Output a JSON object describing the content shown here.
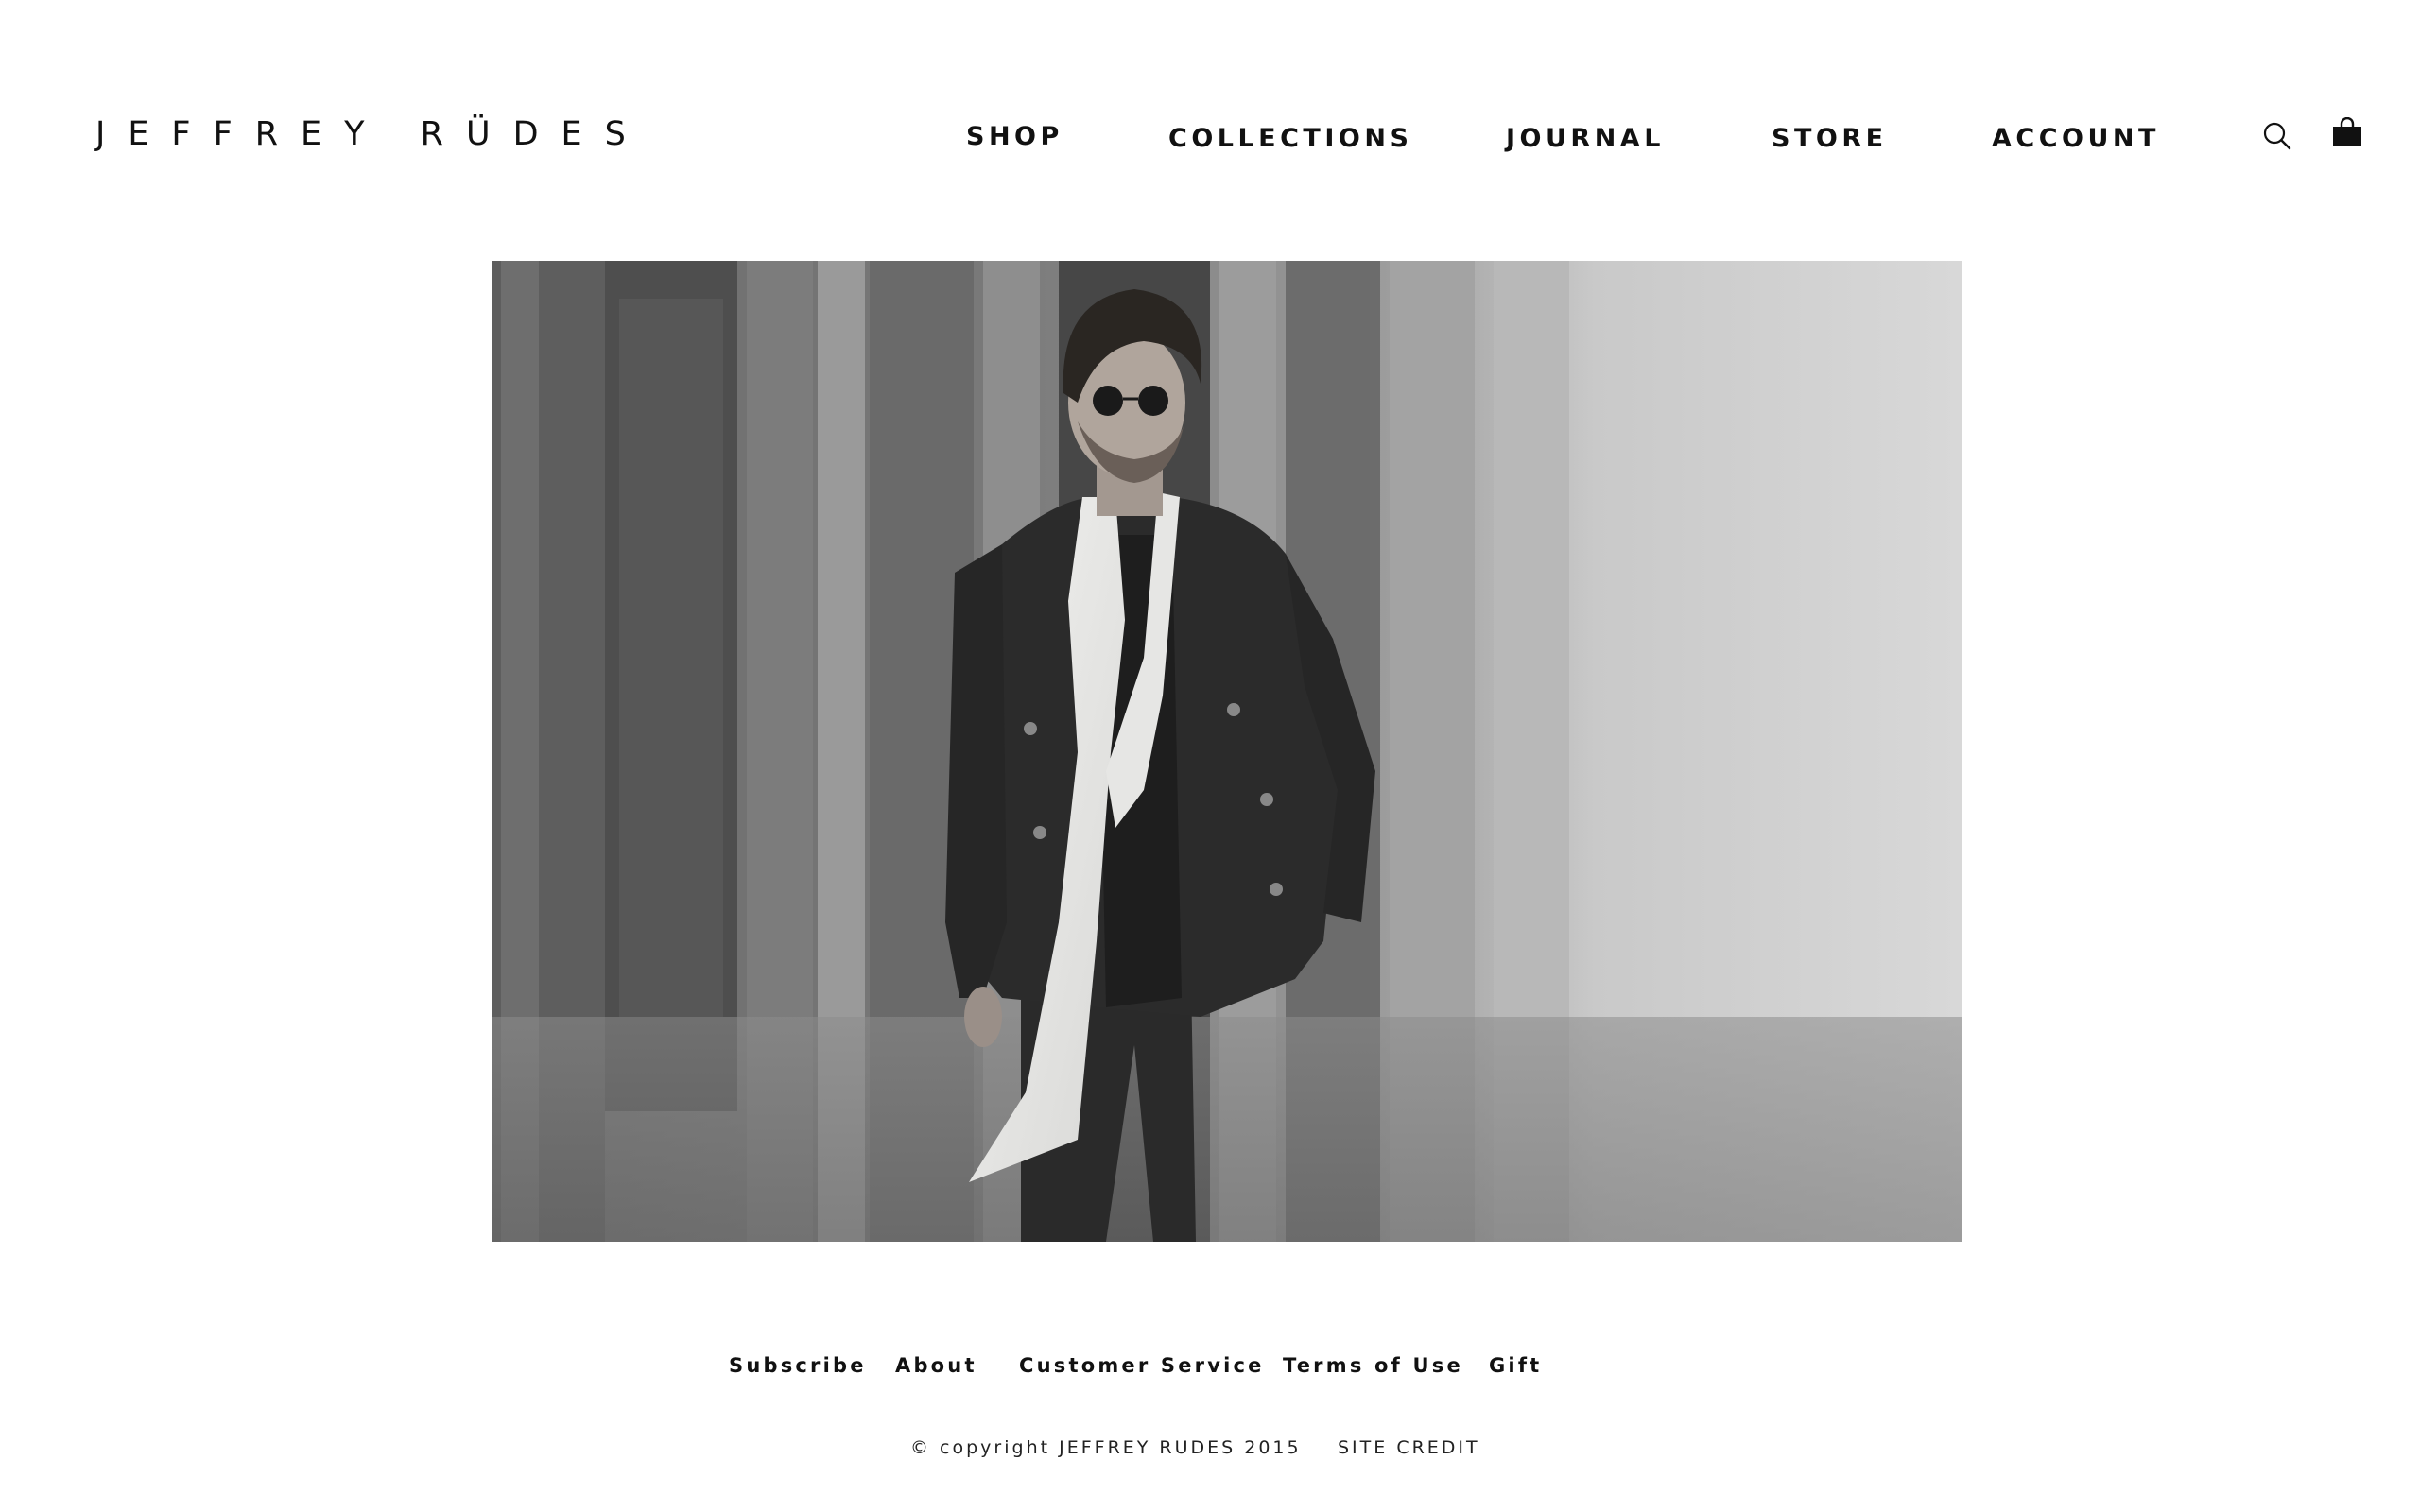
{
  "header": {
    "logo": "JEFFREY RÜDES",
    "nav": {
      "shop": "SHOP",
      "collections": "COLLECTIONS",
      "journal": "JOURNAL",
      "store": "STORE",
      "account": "ACCOUNT"
    },
    "icons": {
      "search": "search-icon",
      "bag": "shopping-bag-icon"
    }
  },
  "hero": {
    "image": "black-and-white photo of man in double-breasted coat, sunglasses and white scarf walking in a colonnade"
  },
  "footer": {
    "links": {
      "subscribe": "Subscribe",
      "about": "About",
      "customer_service": "Customer Service",
      "terms": "Terms of Use",
      "gift": "Gift"
    },
    "copyright": "© copyright JEFFREY RUDES 2015",
    "site_credit": "SITE CREDIT"
  },
  "colors": {
    "background": "#ffffff",
    "text": "#111111"
  }
}
